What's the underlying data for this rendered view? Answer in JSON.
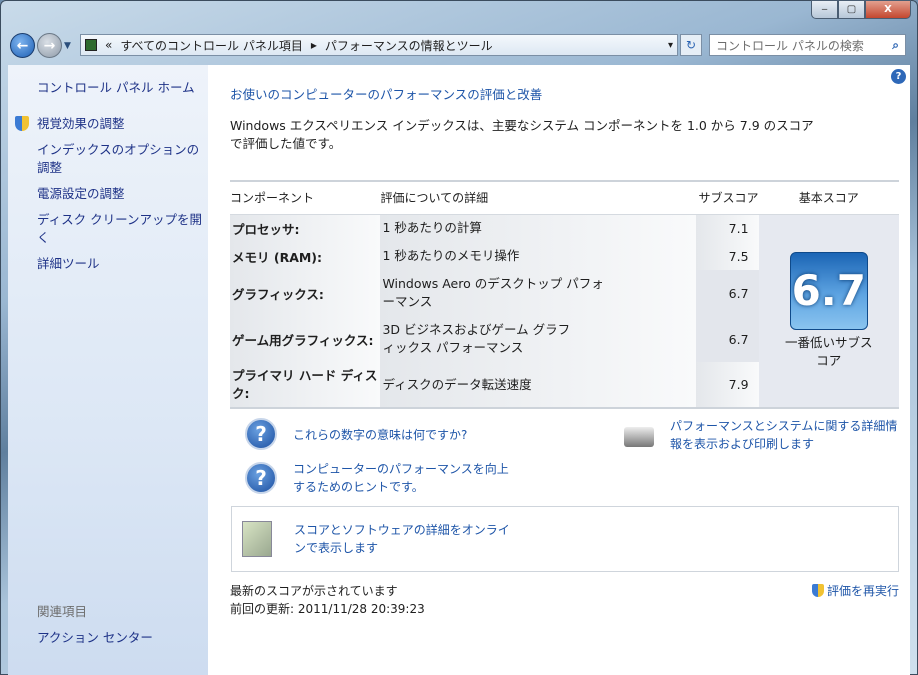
{
  "window": {
    "min": "‒",
    "max": "▢",
    "close": "X"
  },
  "address": {
    "sep": "«",
    "crumb1": "すべてのコントロール パネル項目",
    "arrow": "▸",
    "crumb2": "パフォーマンスの情報とツール",
    "dropdown": "▾",
    "refresh": "↻",
    "search_placeholder": "コントロール パネルの検索",
    "search_icon": "⌕"
  },
  "sidebar": {
    "home": "コントロール パネル ホーム",
    "items": [
      "視覚効果の調整",
      "インデックスのオプションの調整",
      "電源設定の調整",
      "ディスク クリーンアップを開く",
      "詳細ツール"
    ],
    "related_heading": "関連項目",
    "related": [
      "アクション センター"
    ]
  },
  "main": {
    "help": "?",
    "title": "お使いのコンピューターのパフォーマンスの評価と改善",
    "description": "Windows エクスペリエンス インデックスは、主要なシステム コンポーネントを 1.0 から 7.9 のスコアで評価した値です。",
    "table": {
      "headers": [
        "コンポーネント",
        "評価についての詳細",
        "サブスコア",
        "基本スコア"
      ],
      "rows": [
        {
          "component": "プロセッサ:",
          "detail": "1 秒あたりの計算",
          "score": "7.1"
        },
        {
          "component": "メモリ (RAM):",
          "detail": "1 秒あたりのメモリ操作",
          "score": "7.5"
        },
        {
          "component": "グラフィックス:",
          "detail": "Windows Aero のデスクトップ パフォーマンス",
          "score": "6.7"
        },
        {
          "component": "ゲーム用グラフィックス:",
          "detail": "3D ビジネスおよびゲーム グラフィックス パフォーマンス",
          "score": "6.7"
        },
        {
          "component": "プライマリ ハード ディスク:",
          "detail": "ディスクのデータ転送速度",
          "score": "7.9"
        }
      ],
      "base_score": "6.7",
      "base_label": "一番低いサブスコア"
    },
    "links": {
      "meaning": "これらの数字の意味は何ですか?",
      "tips": "コンピューターのパフォーマンスを向上するためのヒントです。",
      "print": "パフォーマンスとシステムに関する詳細情報を表示および印刷します",
      "online": "スコアとソフトウェアの詳細をオンラインで表示します",
      "rerun": "評価を再実行"
    },
    "status": "最新のスコアが示されています",
    "last_update": "前回の更新: 2011/11/28 20:39:23"
  }
}
